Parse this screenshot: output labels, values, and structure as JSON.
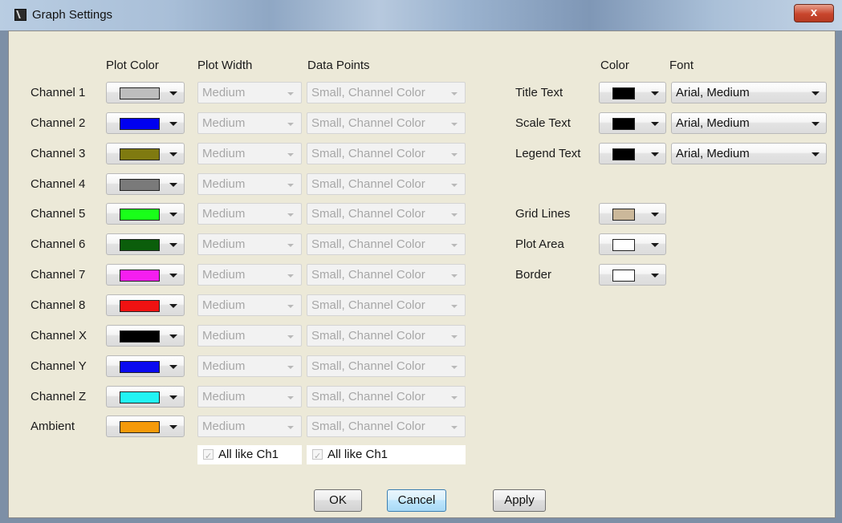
{
  "window": {
    "title": "Graph Settings",
    "close_label": "x"
  },
  "headers": {
    "plot_color": "Plot Color",
    "plot_width": "Plot Width",
    "data_points": "Data Points",
    "color": "Color",
    "font": "Font"
  },
  "channels": [
    {
      "name": "Channel 1",
      "color": "#bdbdbd",
      "width": "Medium",
      "points": "Small, Channel Color"
    },
    {
      "name": "Channel 2",
      "color": "#0000f0",
      "width": "Medium",
      "points": "Small, Channel Color"
    },
    {
      "name": "Channel 3",
      "color": "#7f7a10",
      "width": "Medium",
      "points": "Small, Channel Color"
    },
    {
      "name": "Channel 4",
      "color": "#7a7a7a",
      "width": "Medium",
      "points": "Small, Channel Color"
    },
    {
      "name": "Channel 5",
      "color": "#19ff19",
      "width": "Medium",
      "points": "Small, Channel Color"
    },
    {
      "name": "Channel 6",
      "color": "#0b5e0b",
      "width": "Medium",
      "points": "Small, Channel Color"
    },
    {
      "name": "Channel 7",
      "color": "#f51ef0",
      "width": "Medium",
      "points": "Small, Channel Color"
    },
    {
      "name": "Channel 8",
      "color": "#f01212",
      "width": "Medium",
      "points": "Small, Channel Color"
    },
    {
      "name": "Channel X",
      "color": "#000000",
      "width": "Medium",
      "points": "Small, Channel Color"
    },
    {
      "name": "Channel Y",
      "color": "#0a0af0",
      "width": "Medium",
      "points": "Small, Channel Color"
    },
    {
      "name": "Channel Z",
      "color": "#22f4f4",
      "width": "Medium",
      "points": "Small, Channel Color"
    },
    {
      "name": "Ambient",
      "color": "#f59a0a",
      "width": "Medium",
      "points": "Small, Channel Color"
    }
  ],
  "all_like": {
    "width_label": "All like Ch1",
    "points_label": "All like Ch1"
  },
  "text_settings": [
    {
      "name": "Title Text",
      "color": "#000000",
      "font": "Arial, Medium"
    },
    {
      "name": "Scale Text",
      "color": "#000000",
      "font": "Arial, Medium"
    },
    {
      "name": "Legend Text",
      "color": "#000000",
      "font": "Arial, Medium"
    }
  ],
  "area_settings": [
    {
      "name": "Grid Lines",
      "color": "#cbb89a"
    },
    {
      "name": "Plot Area",
      "color": "#ffffff"
    },
    {
      "name": "Border",
      "color": "#ffffff"
    }
  ],
  "buttons": {
    "ok": "OK",
    "cancel": "Cancel",
    "apply": "Apply"
  }
}
